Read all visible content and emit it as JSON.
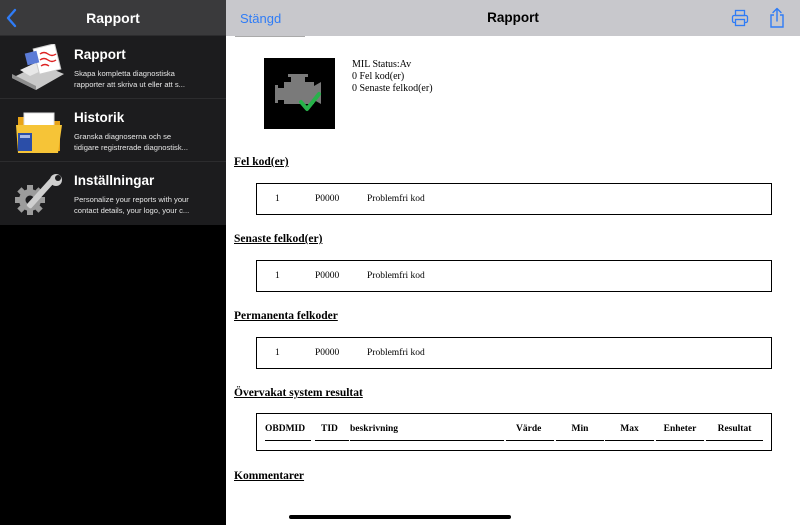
{
  "sidebar": {
    "title": "Rapport",
    "items": [
      {
        "title": "Rapport",
        "line1": "Skapa kompletta diagnostiska",
        "line2": "rapporter att skriva ut eller att s..."
      },
      {
        "title": "Historik",
        "line1": "Granska diagnoserna och se",
        "line2": "tidigare registrerade diagnostisk..."
      },
      {
        "title": "Inställningar",
        "line1": "Personalize your reports with your",
        "line2": "contact details, your logo, your c..."
      }
    ]
  },
  "report": {
    "close_label": "Stängd",
    "title": "Rapport",
    "mil": {
      "status": "MIL Status:Av",
      "faults": "0 Fel kod(er)",
      "recent": "0 Senaste felkod(er)"
    },
    "sections": [
      {
        "heading": "Fel kod(er)",
        "row": {
          "index": "1",
          "code": "P0000",
          "description": "Problemfri kod"
        }
      },
      {
        "heading": "Senaste felkod(er)",
        "row": {
          "index": "1",
          "code": "P0000",
          "description": "Problemfri kod"
        }
      },
      {
        "heading": "Permanenta felkoder",
        "row": {
          "index": "1",
          "code": "P0000",
          "description": "Problemfri kod"
        }
      }
    ],
    "monitor": {
      "heading": "Övervakat system resultat",
      "columns": [
        "OBDMID",
        "TID",
        "beskrivning",
        "Värde",
        "Min",
        "Max",
        "Enheter",
        "Resultat"
      ]
    },
    "comments_heading": "Kommentarer"
  },
  "colors": {
    "accent": "#2f7cf6",
    "sidebar_bg": "#1c1c1e",
    "nav_bg": "#c8c8cc"
  }
}
